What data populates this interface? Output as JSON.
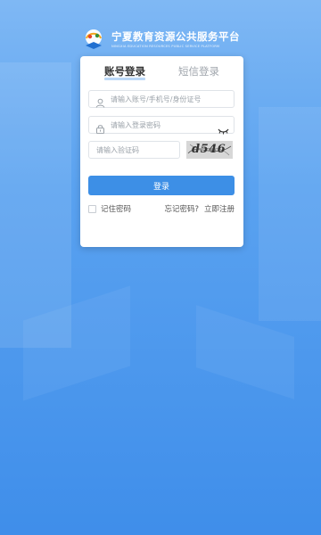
{
  "brand": {
    "title": "宁夏教育资源公共服务平台",
    "subtitle": "NINGXIA EDUCATION RESOURCES PUBLIC SERVICE PLATFORM"
  },
  "tabs": {
    "account": "账号登录",
    "sms": "短信登录"
  },
  "form": {
    "account_placeholder": "请输入账号/手机号/身份证号",
    "password_placeholder": "请输入登录密码",
    "code_placeholder": "请输入验证码",
    "captcha_text": "d546",
    "login_label": "登录",
    "remember_label": "记住密码",
    "forgot_label": "忘记密码?",
    "register_label": "立即注册"
  },
  "colors": {
    "accent": "#3d8fe6",
    "bg_top": "#7fb8f4",
    "bg_bottom": "#3f8eea"
  },
  "icons": {
    "user": "user-icon",
    "lock": "lock-icon",
    "eye": "eye-closed-icon"
  }
}
